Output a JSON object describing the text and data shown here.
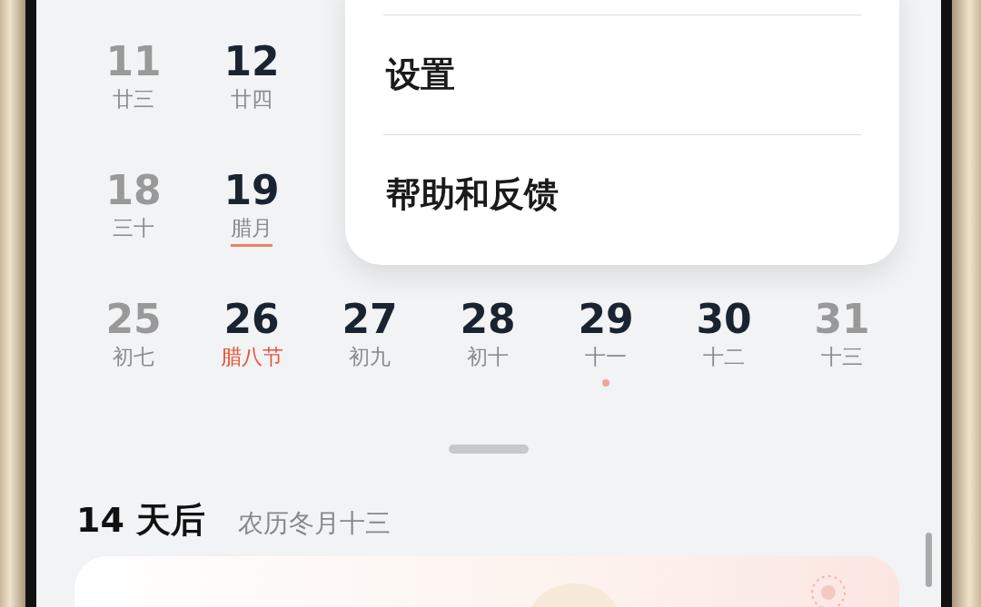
{
  "calendar": {
    "weeks": [
      {
        "days": [
          {
            "day": "11",
            "lunar": "廿三",
            "muted": true,
            "festival": false,
            "selected": false,
            "dot": false
          },
          {
            "day": "12",
            "lunar": "廿四",
            "muted": false,
            "festival": false,
            "selected": false,
            "dot": false
          }
        ]
      },
      {
        "days": [
          {
            "day": "18",
            "lunar": "三十",
            "muted": true,
            "festival": false,
            "selected": false,
            "dot": false
          },
          {
            "day": "19",
            "lunar": "腊月",
            "muted": false,
            "festival": false,
            "selected": true,
            "dot": false
          }
        ]
      },
      {
        "days": [
          {
            "day": "25",
            "lunar": "初七",
            "muted": true,
            "festival": false,
            "selected": false,
            "dot": false
          },
          {
            "day": "26",
            "lunar": "腊八节",
            "muted": false,
            "festival": true,
            "selected": false,
            "dot": false
          },
          {
            "day": "27",
            "lunar": "初九",
            "muted": false,
            "festival": false,
            "selected": false,
            "dot": false
          },
          {
            "day": "28",
            "lunar": "初十",
            "muted": false,
            "festival": false,
            "selected": false,
            "dot": false
          },
          {
            "day": "29",
            "lunar": "十一",
            "muted": false,
            "festival": false,
            "selected": false,
            "dot": true
          },
          {
            "day": "30",
            "lunar": "十二",
            "muted": false,
            "festival": false,
            "selected": false,
            "dot": false
          },
          {
            "day": "31",
            "lunar": "十三",
            "muted": true,
            "festival": false,
            "selected": false,
            "dot": false
          }
        ]
      }
    ]
  },
  "menu": {
    "items": [
      {
        "label": "设置"
      },
      {
        "label": "帮助和反馈"
      }
    ]
  },
  "upcoming": {
    "title": "14 天后",
    "subtitle": "农历冬月十三"
  }
}
